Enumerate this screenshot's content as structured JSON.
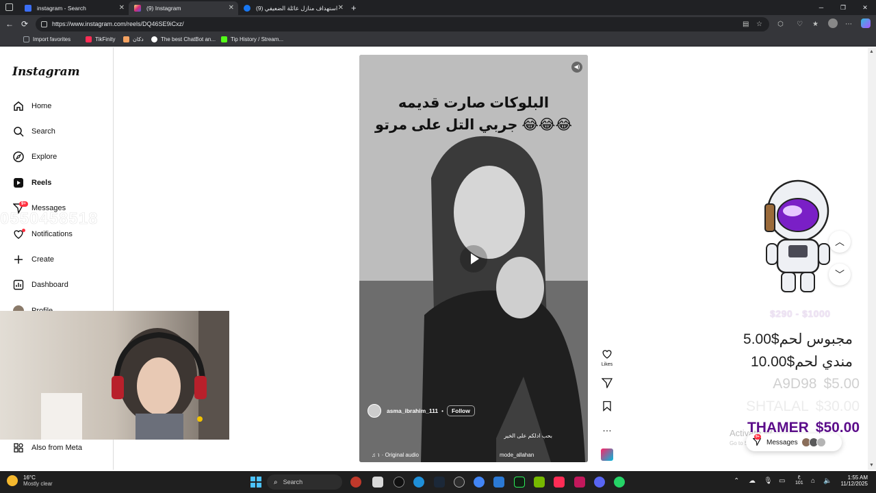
{
  "browser": {
    "tabs": [
      {
        "title": "instagram - Search",
        "favicon_color": "#3b6ef5"
      },
      {
        "title": "(9) Instagram",
        "favicon_color": "#dd2a7b"
      },
      {
        "title": "استهداف منازل عائلة الضعيفي (9)",
        "favicon_color": "#1877f2"
      }
    ],
    "new_tab": "+",
    "url": "https://www.instagram.com/reels/DQ46SE9iCxz/",
    "bookmarks": [
      {
        "label": "Import favorites",
        "color": "#9aa0a6"
      },
      {
        "label": "TikFinity",
        "color": "#ff2d55"
      },
      {
        "label": "دكان",
        "color": "#f4a261"
      },
      {
        "label": "The best ChatBot an...",
        "color": "#ffffff"
      },
      {
        "label": "Tip History / Stream...",
        "color": "#53fc18"
      }
    ],
    "window_controls": [
      "─",
      "❐",
      "✕"
    ]
  },
  "instagram": {
    "logo": "Instagram",
    "nav": [
      {
        "id": "home",
        "label": "Home",
        "icon": "home-icon"
      },
      {
        "id": "search",
        "label": "Search",
        "icon": "search-icon"
      },
      {
        "id": "explore",
        "label": "Explore",
        "icon": "compass-icon"
      },
      {
        "id": "reels",
        "label": "Reels",
        "icon": "reels-icon",
        "active": true
      },
      {
        "id": "messages",
        "label": "Messages",
        "icon": "send-icon",
        "badge": "9+"
      },
      {
        "id": "notifications",
        "label": "Notifications",
        "icon": "heart-icon"
      },
      {
        "id": "create",
        "label": "Create",
        "icon": "plus-icon"
      },
      {
        "id": "dashboard",
        "label": "Dashboard",
        "icon": "dashboard-icon"
      },
      {
        "id": "profile",
        "label": "Profile",
        "icon": "avatar"
      },
      {
        "id": "also_from_meta",
        "label": "Also from Meta",
        "icon": "grid-icon"
      }
    ],
    "ghost_number": "0550458518",
    "reel": {
      "caption_line1": "البلوكات صارت قديمه",
      "caption_line2": "😂😂😂 جربي التل على مرتو",
      "username": "asma_ibrahim_111",
      "dot": "•",
      "follow_label": "Follow",
      "subcaption": "بحب ادلكم على الخير",
      "audio": "♫ ١ · Original audio",
      "audio_user": "mode_allahan"
    },
    "actions": {
      "likes_label": "Likes",
      "more": "…"
    }
  },
  "stream_overlay": {
    "goal_range": "$290 - $1000",
    "donations": [
      {
        "name": "مجبوس لحم",
        "amount": "$5.00"
      },
      {
        "name": "مندي لحم",
        "amount": "$10.00"
      },
      {
        "name": "A9D98",
        "amount": "$5.00"
      },
      {
        "name": "SHTALAL",
        "amount": "$30.00"
      },
      {
        "name": "THAMER",
        "amount": "$50.00"
      }
    ],
    "watermark_title": "Activate W",
    "watermark_sub": "Go to Setti",
    "messages_pill": {
      "label": "Messages",
      "badge": "9+"
    }
  },
  "taskbar": {
    "weather_temp": "16°C",
    "weather_desc": "Mostly clear",
    "search_label": "Search",
    "tray_number": "101",
    "tray_symbol": "ع",
    "time": "1:55 AM",
    "date": "11/12/2025"
  },
  "colors": {
    "instagram_badge": "#ff3040",
    "donation_highlight": "#5b0c8a",
    "accent_blue": "#4cc2ff"
  }
}
